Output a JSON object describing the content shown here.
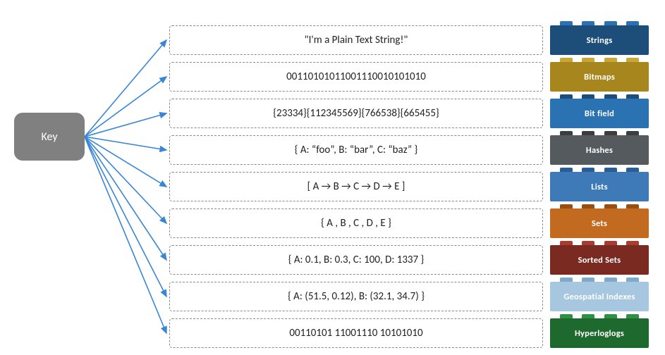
{
  "key": {
    "label": "Key"
  },
  "arrow_color": "#3a86d6",
  "rows": [
    {
      "value": "\"I'm a Plain Text String!\"",
      "type": "Strings",
      "bg": "#1d4e7a",
      "peg": "#2a72b1"
    },
    {
      "value": "00110101011001110010101010",
      "type": "Bitmaps",
      "bg": "#a8861e",
      "peg": "#c9a63a"
    },
    {
      "value": "{23334}{112345569}{766538}{665455}",
      "type": "Bit field",
      "bg": "#2a72b1",
      "peg": "#1d4e7a"
    },
    {
      "value": "{ A: “foo”, B: “bar”, C: “baz” }",
      "type": "Hashes",
      "bg": "#555a5e",
      "peg": "#3a3e41"
    },
    {
      "value": "[ A → B → C → D → E ]",
      "type": "Lists",
      "bg": "#3f7ab8",
      "peg": "#2a5d94"
    },
    {
      "value": "{ A , B , C , D , E }",
      "type": "Sets",
      "bg": "#c26a1f",
      "peg": "#9a4f12"
    },
    {
      "value": "{ A: 0.1, B: 0.3, C: 100, D: 1337 }",
      "type": "Sorted Sets",
      "bg": "#7a2a21",
      "peg": "#a83c31"
    },
    {
      "value": "{ A: (51.5, 0.12), B: (32.1, 34.7) }",
      "type": "Geospatial Indexes",
      "bg": "#a7c7e0",
      "peg": "#7ea9c9"
    },
    {
      "value": "00110101 11001110 10101010",
      "type": "Hyperloglogs",
      "bg": "#1e6a2e",
      "peg": "#2f8f45"
    }
  ]
}
